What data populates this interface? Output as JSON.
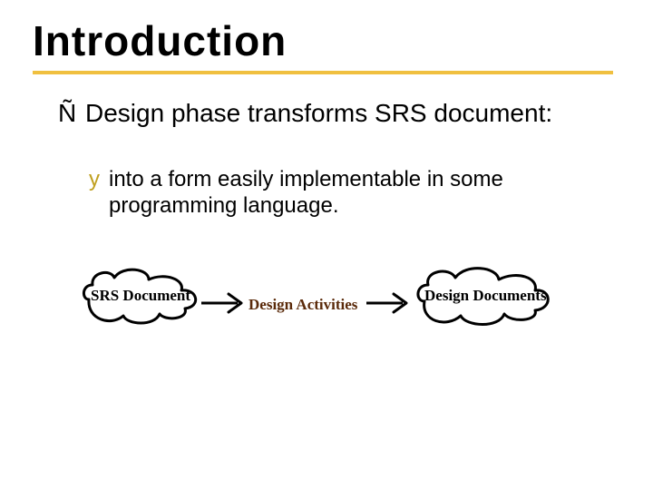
{
  "title": "Introduction",
  "bullet1": {
    "symbol": "Ñ",
    "text": "Design phase  transforms SRS document:"
  },
  "bullet2": {
    "symbol": "y",
    "text": "into a form easily implementable in some programming language."
  },
  "diagram": {
    "left_label": "SRS Document",
    "middle_label": "Design Activities",
    "right_label": "Design Documents"
  }
}
